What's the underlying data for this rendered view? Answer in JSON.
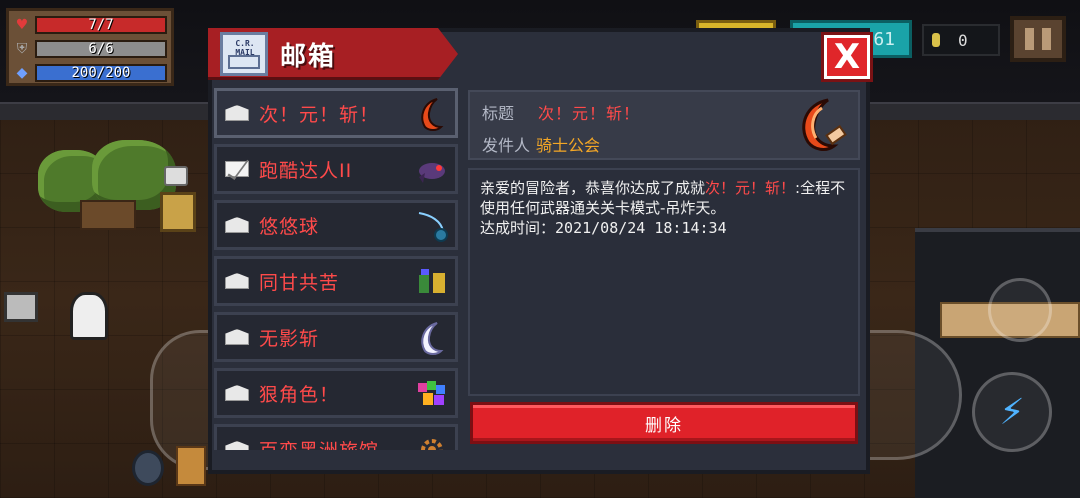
{
  "hud": {
    "hp": {
      "current": 7,
      "max": 7,
      "text": "7/7",
      "fraction": 1.0
    },
    "armor": {
      "current": 6,
      "max": 6,
      "text": "6/6",
      "fraction": 1.0
    },
    "energy": {
      "current": 200,
      "max": 200,
      "text": "200/200",
      "fraction": 1.0
    },
    "gems_partial": "61",
    "coins": "0"
  },
  "mailbox": {
    "title": "邮箱",
    "icon_caption": "C.R.\nMAIL",
    "close_label": "X",
    "items": [
      {
        "label": "次！元！斩！",
        "envelope": "opened",
        "thumb": "crescent-blade-red-icon",
        "selected": true
      },
      {
        "label": "跑酷达人II",
        "envelope": "closed",
        "thumb": "purple-creature-icon",
        "selected": false
      },
      {
        "label": "悠悠球",
        "envelope": "opened",
        "thumb": "yoyo-icon",
        "selected": false
      },
      {
        "label": "同甘共苦",
        "envelope": "opened",
        "thumb": "duo-characters-icon",
        "selected": false
      },
      {
        "label": "无影斩",
        "envelope": "opened",
        "thumb": "crescent-blade-white-icon",
        "selected": false
      },
      {
        "label": "狠角色！",
        "envelope": "opened",
        "thumb": "colorful-characters-icon",
        "selected": false
      },
      {
        "label": "百变黑洲旅馆",
        "envelope": "opened",
        "thumb": "gear-icon",
        "selected": false
      }
    ],
    "detail": {
      "title_key": "标题",
      "title_value": "次！元！斩！",
      "sender_key": "发件人",
      "sender_value": "骑士公会",
      "body_prefix": "亲爱的冒险者，恭喜你达成了成就",
      "body_achievement": "次！元！斩！",
      "body_suffix": ":全程不使用任何武器通关关卡模式-吊炸天。",
      "time_label": "达成时间：",
      "time_value": "2021/08/24 18:14:34"
    },
    "delete_label": "删除"
  }
}
